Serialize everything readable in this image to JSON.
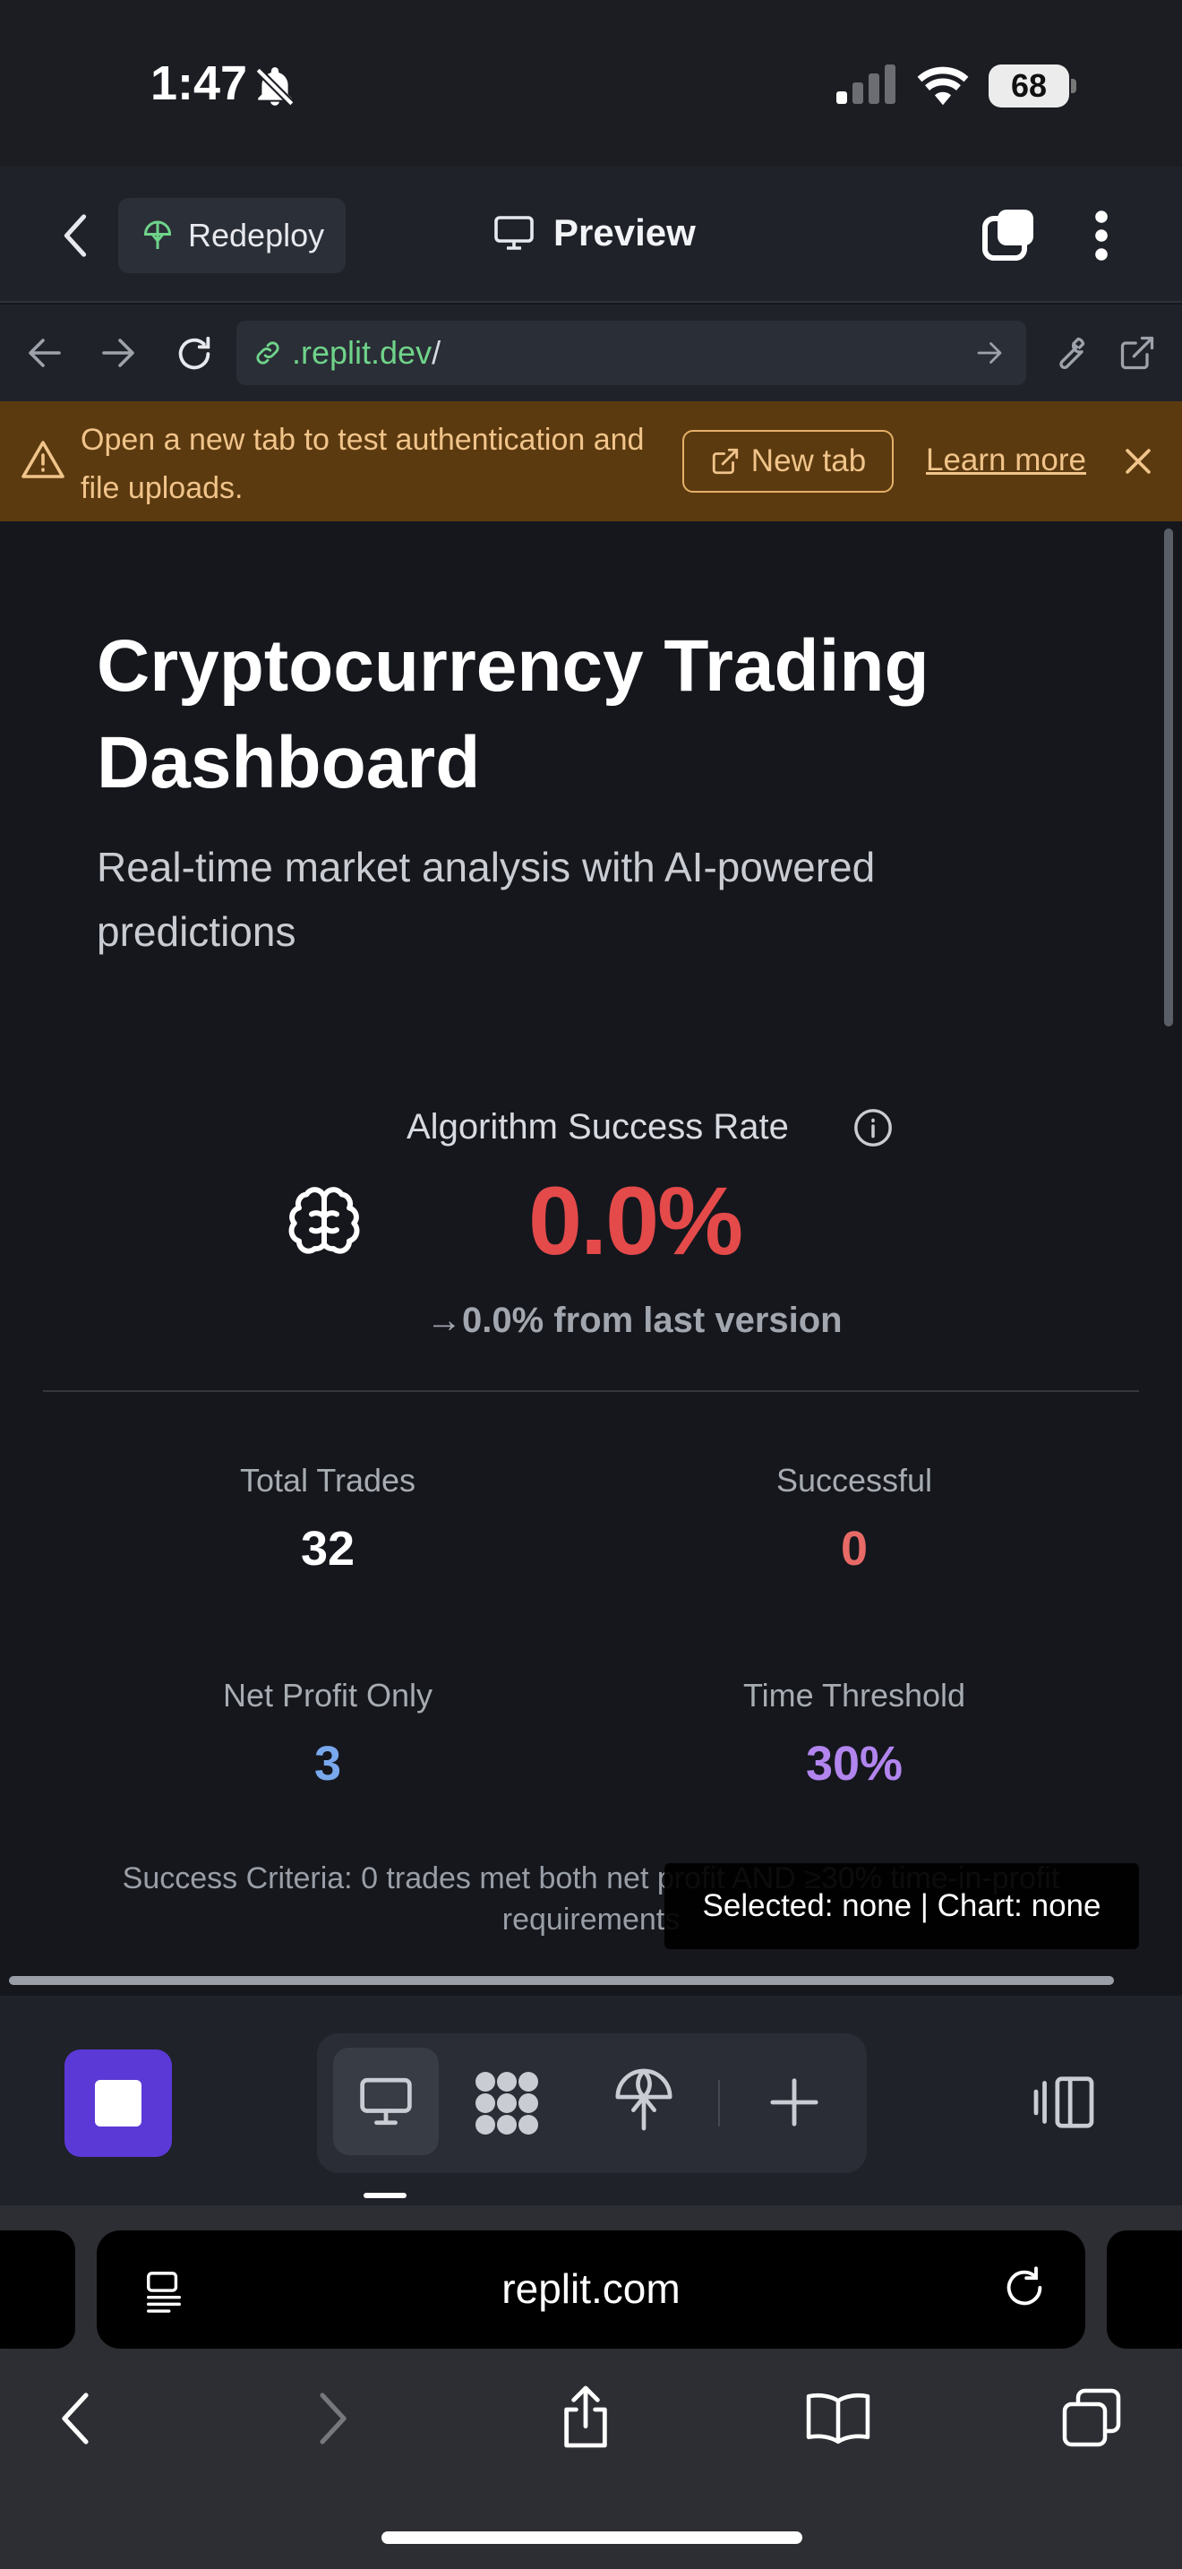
{
  "status_bar": {
    "time": "1:47",
    "battery": "68"
  },
  "header": {
    "redeploy_label": "Redeploy",
    "preview_label": "Preview"
  },
  "url_bar": {
    "domain_highlight": ".replit.dev",
    "path": "/"
  },
  "banner": {
    "message": "Open a new tab to test authentication and file uploads.",
    "new_tab_label": "New tab",
    "learn_more_label": "Learn more"
  },
  "dashboard": {
    "title": "Cryptocurrency Trading Dashboard",
    "subtitle": "Real-time market analysis with AI-powered predictions",
    "algo_label": "Algorithm Success Rate",
    "success_rate": "0.0%",
    "change": "→0.0% from last version",
    "stats": {
      "total_trades": {
        "label": "Total Trades",
        "value": "32"
      },
      "successful": {
        "label": "Successful",
        "value": "0"
      },
      "net_profit_only": {
        "label": "Net Profit Only",
        "value": "3"
      },
      "time_threshold": {
        "label": "Time Threshold",
        "value": "30%"
      }
    },
    "criteria": "Success Criteria: 0 trades met both net profit AND ≥30% time-in-profit requirements",
    "debug_overlay": "Selected: none | Chart: none"
  },
  "safari": {
    "url": "replit.com"
  },
  "colors": {
    "accent_purple": "#5b39d6",
    "danger_red": "#e44a4a",
    "banner_bg": "#5c3a10",
    "profit_blue": "#79a8ec",
    "threshold_purple": "#b285ee",
    "url_green": "#6fd38a"
  },
  "icons": [
    "bell-slash-icon",
    "signal-icon",
    "wifi-icon",
    "chevron-left-icon",
    "deploy-icon",
    "monitor-icon",
    "tabs-icon",
    "more-vertical-icon",
    "arrow-left-icon",
    "arrow-right-icon",
    "reload-icon",
    "link-icon",
    "wrench-icon",
    "external-link-icon",
    "warning-icon",
    "close-icon",
    "info-icon",
    "brain-icon",
    "stop-icon",
    "grid-icon",
    "plus-icon",
    "panel-toggle-icon",
    "reader-icon",
    "share-icon",
    "bookmarks-icon"
  ]
}
